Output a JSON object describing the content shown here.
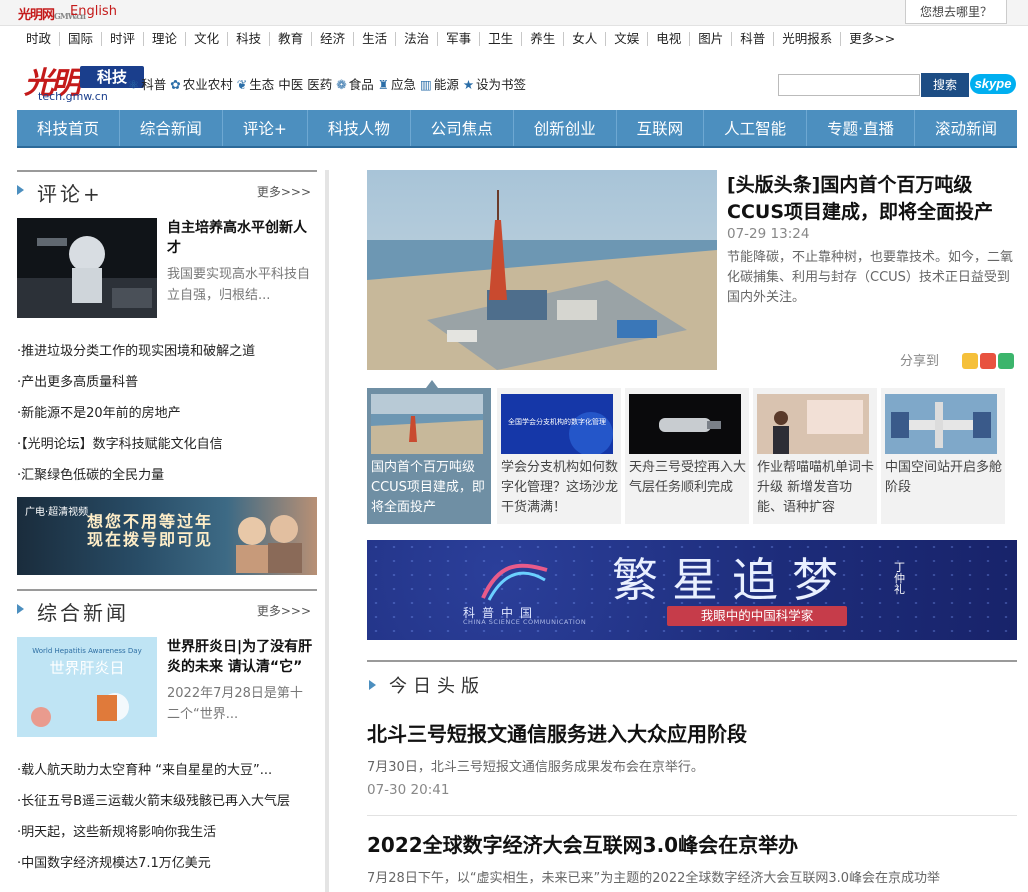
{
  "topbar": {
    "logo_small": "光明网",
    "logo_small_sub": "GMW.cn",
    "english": "English",
    "whereto": "您想去哪里？"
  },
  "channels": [
    "时政",
    "国际",
    "时评",
    "理论",
    "文化",
    "科技",
    "教育",
    "经济",
    "生活",
    "法治",
    "军事",
    "卫生",
    "养生",
    "女人",
    "文娱",
    "电视",
    "图片",
    "科普",
    "光明报系",
    "更多>>"
  ],
  "brand": {
    "name": "光明",
    "section": "科技",
    "domain": "tech.gmw.cn"
  },
  "categories": [
    {
      "icon": "science-icon",
      "glyph": "⚛",
      "label": "科普"
    },
    {
      "icon": "wheat-icon",
      "glyph": "✿",
      "label": "农业农村"
    },
    {
      "icon": "leaf-icon",
      "glyph": "❦",
      "label": "生态"
    },
    {
      "icon": "",
      "glyph": "",
      "label": "中医"
    },
    {
      "icon": "",
      "glyph": "",
      "label": "医药"
    },
    {
      "icon": "food-icon",
      "glyph": "❁",
      "label": "食品"
    },
    {
      "icon": "alarm-icon",
      "glyph": "♜",
      "label": "应急"
    },
    {
      "icon": "energy-icon",
      "glyph": "▥",
      "label": "能源"
    },
    {
      "icon": "star-icon",
      "glyph": "★",
      "label": "设为书签"
    }
  ],
  "search": {
    "placeholder": "",
    "button": "搜索",
    "skype": "skype"
  },
  "nav": [
    "科技首页",
    "综合新闻",
    "评论+",
    "科技人物",
    "公司焦点",
    "创新创业",
    "互联网",
    "人工智能",
    "专题·直播",
    "滚动新闻"
  ],
  "commentary": {
    "title": "评论+",
    "more": "更多>>>",
    "feature": {
      "title": "自主培养高水平创新人才",
      "summary": "我国要实现高水平科技自立自强，归根结..."
    },
    "items": [
      "·推进垃圾分类工作的现实困境和破解之道",
      "·产出更多高质量科普",
      "·新能源不是20年前的房地产",
      "·【光明论坛】数字科技赋能文化自信",
      "·汇聚绿色低碳的全民力量"
    ]
  },
  "ad": {
    "brand": "广电·超清视频",
    "line1": "想您不用等过年",
    "line2": "现在拨号即可见"
  },
  "general_news": {
    "title": "综合新闻",
    "more": "更多>>>",
    "feature": {
      "title": "世界肝炎日|为了没有肝炎的未来 请认清“它”",
      "summary": "2022年7月28日是第十二个“世界..."
    },
    "items": [
      "·载人航天助力太空育种 “来自星星的大豆”...",
      "·长征五号B遥三运载火箭末级残骸已再入大气层",
      "·明天起，这些新规将影响你我生活",
      "·中国数字经济规模达7.1万亿美元"
    ]
  },
  "hero": {
    "title": "[头版头条]国内首个百万吨级CCUS项目建成，即将全面投产",
    "time": "07-29 13:24",
    "summary": "节能降碳，不止靠种树，也要靠技术。如今，二氧化碳捕集、利用与封存（CCUS）技术正日益受到国内外关注。",
    "share": "分享到"
  },
  "thumbs": [
    {
      "caption": "国内首个百万吨级CCUS项目建成，即将全面投产"
    },
    {
      "caption": "学会分支机构如何数字化管理？这场沙龙干货满满！"
    },
    {
      "caption": "天舟三号受控再入大气层任务顺利完成"
    },
    {
      "caption": "作业帮喵喵机单词卡升级 新增发音功能、语种扩容"
    },
    {
      "caption": "中国空间站开启多舱阶段"
    }
  ],
  "thumb_overlay": "全国学会分支机构的数字化管理",
  "promo": {
    "title": "繁星追梦",
    "subtitle": "我眼中的中国科学家",
    "org": "科普中国",
    "org_en": "CHINA SCIENCE COMMUNICATION",
    "sign": "丁仲礼"
  },
  "today": {
    "title": "今日头版",
    "stories": [
      {
        "title": "北斗三号短报文通信服务进入大众应用阶段",
        "summary": "7月30日，北斗三号短报文通信服务成果发布会在京举行。",
        "time": "07-30 20:41"
      },
      {
        "title": "2022全球数字经济大会互联网3.0峰会在京举办",
        "summary": "7月28日下午，以“虚实相生，未来已来”为主题的2022全球数字经济大会互联网3.0峰会在京成功举",
        "time": ""
      }
    ]
  },
  "colors": {
    "nav_blue": "#4c8fbf",
    "brand_red": "#c41a1a",
    "search_blue": "#1d4d84"
  }
}
